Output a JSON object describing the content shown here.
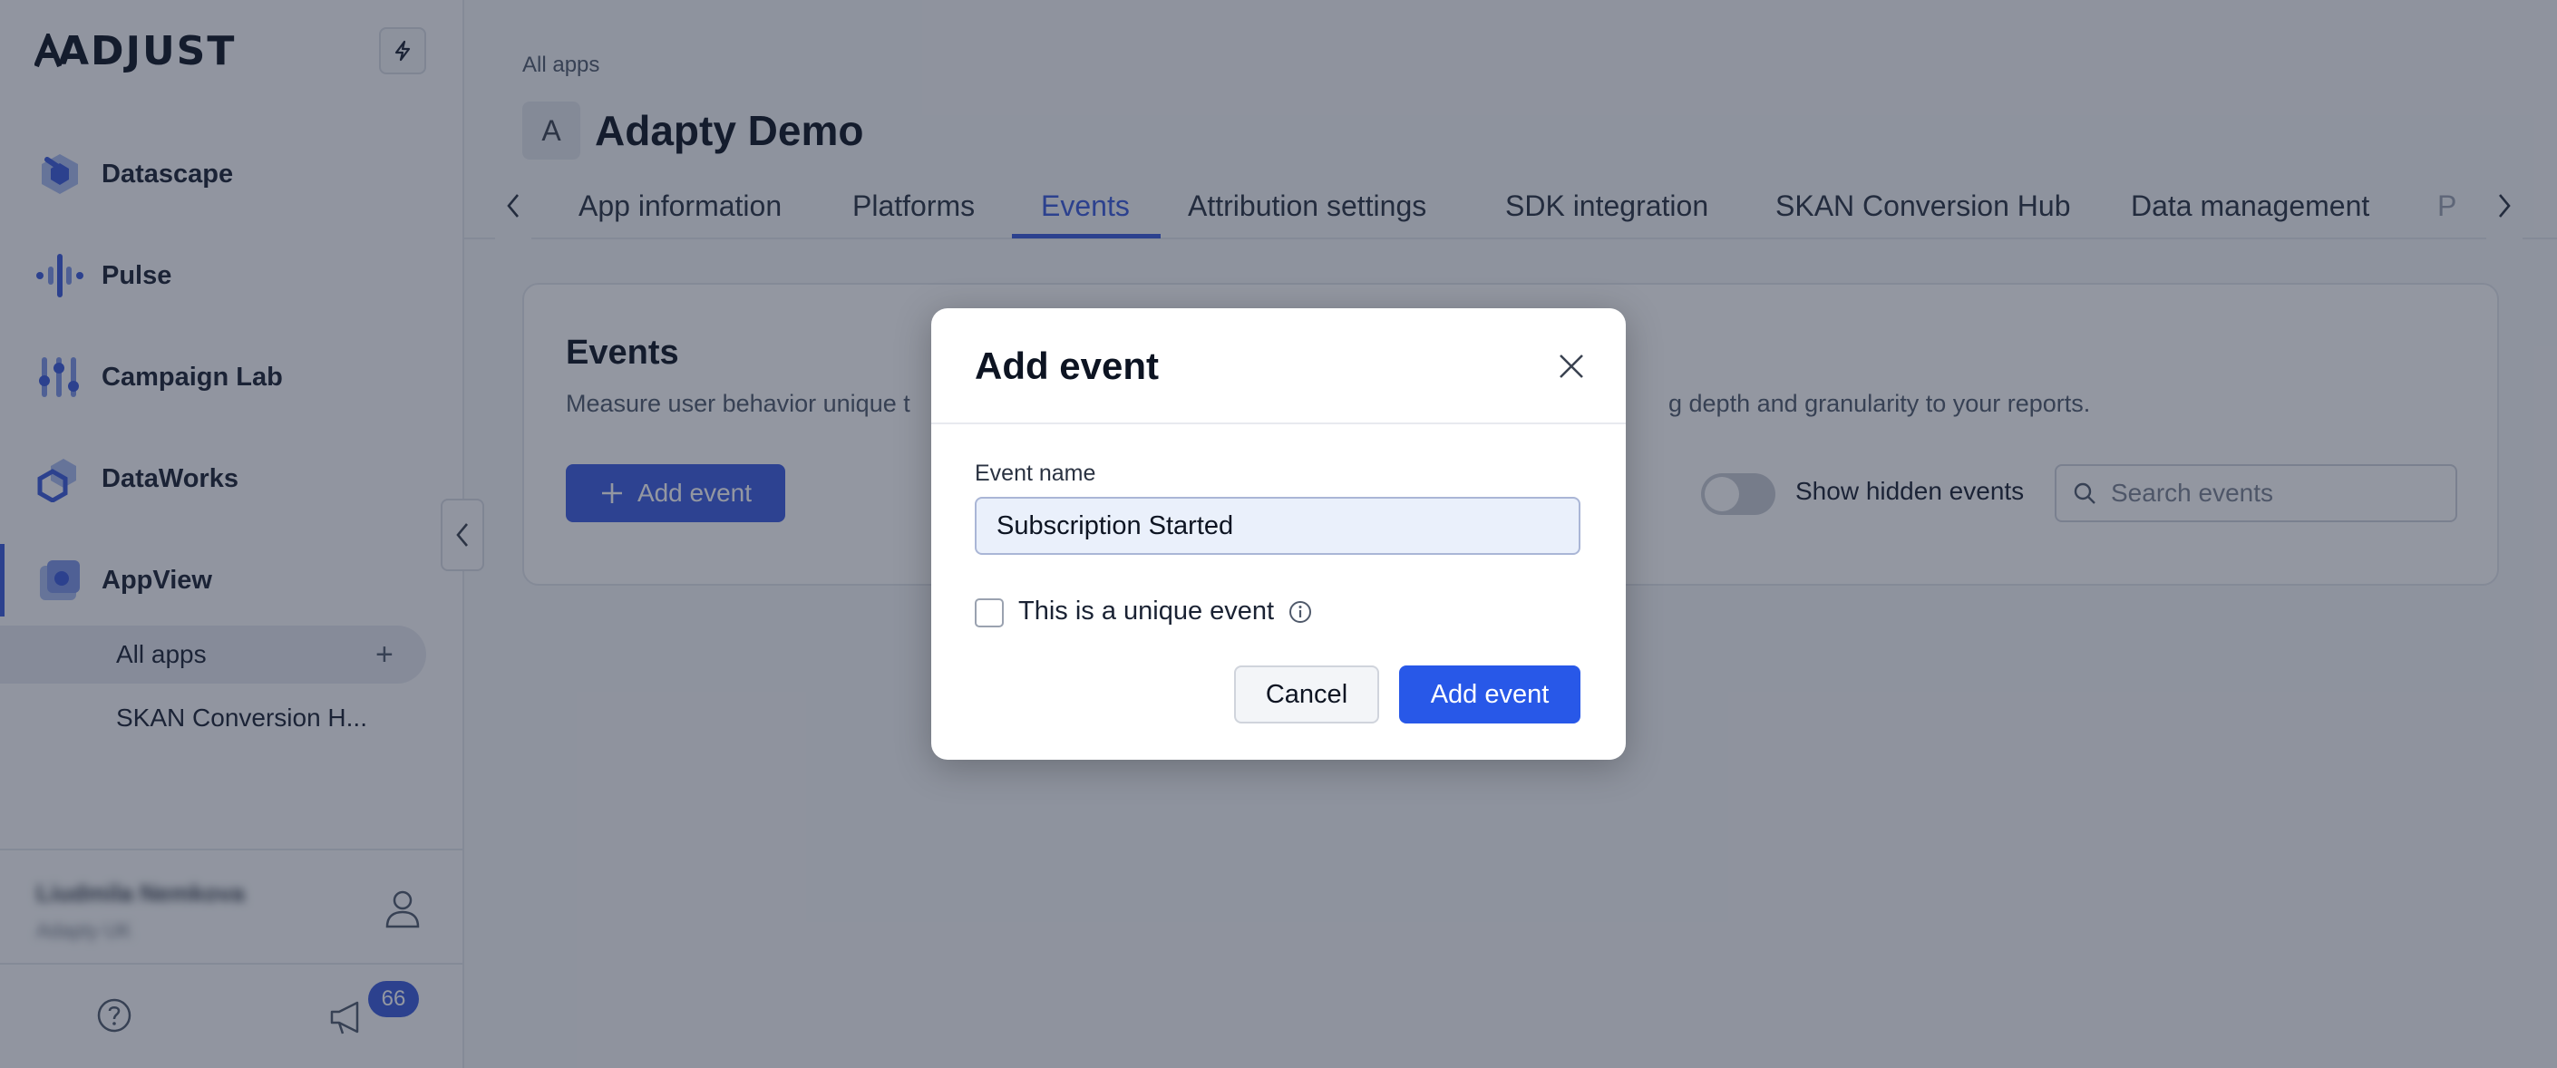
{
  "sidebar": {
    "logo": "ADJUST",
    "nav": [
      {
        "label": "Datascape",
        "icon": "datascape-icon"
      },
      {
        "label": "Pulse",
        "icon": "pulse-icon"
      },
      {
        "label": "Campaign Lab",
        "icon": "campaign-lab-icon"
      },
      {
        "label": "DataWorks",
        "icon": "dataworks-icon"
      },
      {
        "label": "AppView",
        "icon": "appview-icon"
      }
    ],
    "sub_items": [
      {
        "label": "All apps",
        "selected": true
      },
      {
        "label": "SKAN Conversion H...",
        "selected": false
      }
    ],
    "user": {
      "name": "Liudmila Nemkova",
      "org": "Adapty UK"
    },
    "notifications_count": "66"
  },
  "main": {
    "breadcrumb": "All apps",
    "app_initial": "A",
    "app_title": "Adapty Demo",
    "tabs": [
      {
        "label": "App information"
      },
      {
        "label": "Platforms"
      },
      {
        "label": "Events",
        "active": true
      },
      {
        "label": "Attribution settings"
      },
      {
        "label": "SDK integration"
      },
      {
        "label": "SKAN Conversion Hub"
      },
      {
        "label": "Data management"
      },
      {
        "label": "P"
      }
    ],
    "card": {
      "title": "Events",
      "description_left": "Measure user behavior unique t",
      "description_right": "g depth and granularity to your reports.",
      "add_button": "Add event",
      "toggle_label": "Show hidden events",
      "search_placeholder": "Search events"
    }
  },
  "modal": {
    "title": "Add event",
    "field_label": "Event name",
    "field_value": "Subscription Started",
    "checkbox_label": "This is a unique event",
    "cancel": "Cancel",
    "submit": "Add event"
  },
  "colors": {
    "accent": "#3b5bdb",
    "primary_button": "#2858e8"
  }
}
